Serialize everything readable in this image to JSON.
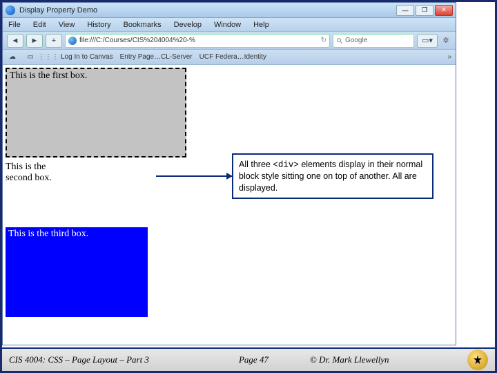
{
  "window": {
    "title": "Display Property Demo",
    "min": "—",
    "restore": "❐",
    "close": "✕"
  },
  "menu": {
    "file": "File",
    "edit": "Edit",
    "view": "View",
    "history": "History",
    "bookmarks": "Bookmarks",
    "develop": "Develop",
    "window": "Window",
    "help": "Help"
  },
  "toolbar": {
    "back": "◄",
    "fwd": "►",
    "add": "+",
    "url": "file:///C:/Courses/CIS%204004%20-%",
    "reload": "↻",
    "search_placeholder": "Google",
    "page_icon": "▭▾",
    "gear": "✲"
  },
  "bookmarks": {
    "i1": "☁",
    "i2": "▭",
    "i3": "⋮⋮⋮",
    "b1": "Log In to Canvas",
    "b2": "Entry Page…CL-Server",
    "b3": "UCF Federa…Identity",
    "more": "»"
  },
  "boxes": {
    "b1": "This is the first box.",
    "b2": "This is the second box.",
    "b3": "This is the third box."
  },
  "callout": {
    "pre": "All three ",
    "code": "<div>",
    "post": " elements display in their normal block style sitting one on top of another.  All are displayed."
  },
  "footer": {
    "left": "CIS 4004: CSS – Page Layout – Part 3",
    "mid": "Page 47",
    "right": "© Dr. Mark Llewellyn"
  }
}
